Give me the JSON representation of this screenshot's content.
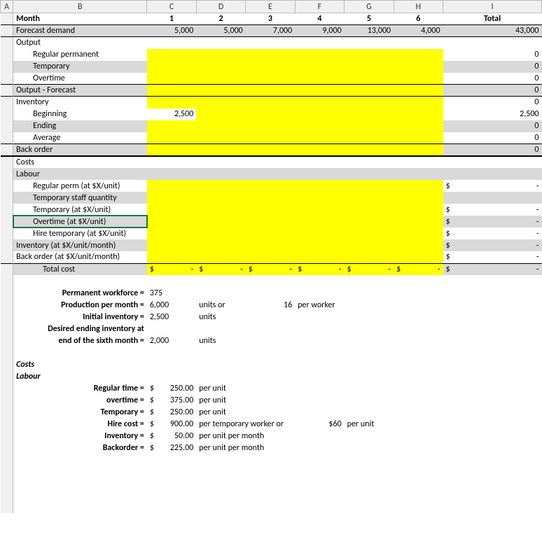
{
  "cols": [
    "A",
    "B",
    "C",
    "D",
    "E",
    "F",
    "G",
    "H",
    "I"
  ],
  "header": {
    "month_label": "Month",
    "months": [
      "1",
      "2",
      "3",
      "4",
      "5",
      "6"
    ],
    "total_label": "Total"
  },
  "forecast": {
    "label": "Forecast demand",
    "vals": [
      "5,000",
      "5,000",
      "7,000",
      "9,000",
      "13,000",
      "4,000"
    ],
    "total": "43,000"
  },
  "output": {
    "label": "Output",
    "regular": {
      "label": "Regular permanent",
      "total": "0"
    },
    "temporary": {
      "label": "Temporary",
      "total": "0"
    },
    "overtime": {
      "label": "Overtime",
      "total": "0"
    }
  },
  "output_forecast": {
    "label": "Output - Forecast",
    "total": "0"
  },
  "inventory": {
    "label": "Inventory",
    "total": "0",
    "beginning": {
      "label": "Beginning",
      "c": "2,500",
      "total": "2,500"
    },
    "ending": {
      "label": "Ending",
      "total": "0"
    },
    "average": {
      "label": "Average",
      "total": "0"
    }
  },
  "backorder": {
    "label": "Back order",
    "total": "0"
  },
  "costs_section": {
    "label": "Costs",
    "labour_label": "Labour",
    "rows": {
      "regperm": {
        "label": "Regular perm (at $X/unit)",
        "dollar": "$",
        "dash": "-"
      },
      "tempqty": {
        "label": "Temporary staff quantity"
      },
      "temp": {
        "label": "Temporary (at $X/unit)",
        "dollar": "$",
        "dash": "-"
      },
      "ot": {
        "label": "Overtime (at $X/unit)",
        "dollar": "$",
        "dash": "-"
      },
      "hire": {
        "label": "Hire temporary (at $X/unit)",
        "dollar": "$",
        "dash": "-"
      },
      "inv": {
        "label": "Inventory (at $X/unit/month)",
        "dollar": "$",
        "dash": "-"
      },
      "bo": {
        "label": "Back order (at $X/unit/month)",
        "dollar": "$",
        "dash": "-"
      },
      "totalcost": {
        "label": "Total cost",
        "cells": [
          "$",
          "-",
          "$",
          "-",
          "$",
          "-",
          "$",
          "-",
          "$",
          "-",
          "$",
          "-"
        ],
        "t_dollar": "$",
        "t_dash": "-"
      }
    }
  },
  "params": {
    "pw": {
      "label": "Permanent workforce =",
      "val": "375"
    },
    "ppm": {
      "label": "Production per month =",
      "val": "6,000",
      "unit": "units or",
      "perw": "16",
      "perw_label": "per worker"
    },
    "ii": {
      "label": "Initial inventory =",
      "val": "2,500",
      "unit": "units"
    },
    "dei_a": {
      "label": "Desired ending inventory at"
    },
    "dei_b": {
      "label": "end of the sixth month =",
      "val": "2,000",
      "unit": "units"
    }
  },
  "costs2": {
    "title": "Costs",
    "labour": "Labour",
    "regtime": {
      "label": "Regular time =",
      "d": "$",
      "v": "250.00",
      "u": "per unit"
    },
    "ot": {
      "label": "overtime =",
      "d": "$",
      "v": "375.00",
      "u": "per unit"
    },
    "temp": {
      "label": "Temporary =",
      "d": "$",
      "v": "250.00",
      "u": "per unit"
    },
    "hire": {
      "label": "Hire cost =",
      "d": "$",
      "v": "900.00",
      "u": "per temporary worker or",
      "alt": "$60",
      "altu": "per unit"
    },
    "inv": {
      "label": "Inventory =",
      "d": "$",
      "v": "50.00",
      "u": "per unit per month"
    },
    "bo": {
      "label": "Backorder =",
      "d": "$",
      "v": "225.00",
      "u": "per unit per month"
    }
  }
}
